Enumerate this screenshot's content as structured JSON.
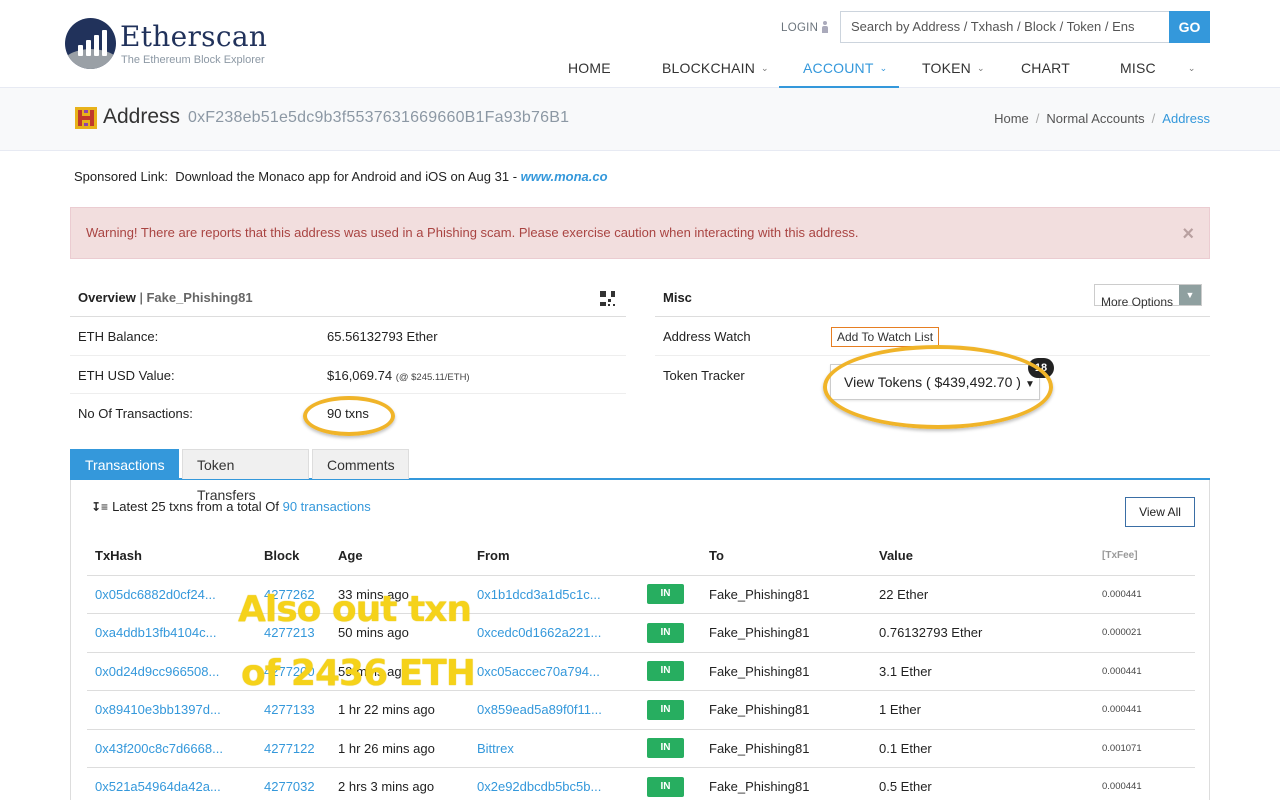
{
  "header": {
    "logo_name": "Etherscan",
    "logo_tagline": "The Ethereum Block Explorer",
    "login_label": "LOGIN",
    "search_placeholder": "Search by Address / Txhash / Block / Token / Ens",
    "go_label": "GO",
    "nav": [
      {
        "label": "HOME",
        "dropdown": false
      },
      {
        "label": "BLOCKCHAIN",
        "dropdown": true
      },
      {
        "label": "ACCOUNT",
        "dropdown": true,
        "active": true
      },
      {
        "label": "TOKEN",
        "dropdown": true
      },
      {
        "label": "CHART",
        "dropdown": false
      },
      {
        "label": "MISC",
        "dropdown": true
      }
    ]
  },
  "title": {
    "label": "Address",
    "hash": "0xF238eb51e5dc9b3f5537631669660B1Fa93b76B1",
    "breadcrumb": [
      "Home",
      "Normal Accounts",
      "Address"
    ]
  },
  "sponsored": {
    "prefix": "Sponsored Link:",
    "text": "Download the Monaco app for Android and iOS on Aug 31 -",
    "link": "www.mona.co"
  },
  "warning": {
    "text": "Warning! There are reports that this address was used in a Phishing scam. Please exercise caution when interacting with this address.",
    "close": "×"
  },
  "overview": {
    "title": "Overview",
    "name_tag": "Fake_Phishing81",
    "rows": [
      {
        "key": "ETH Balance:",
        "value": "65.56132793 Ether",
        "note": ""
      },
      {
        "key": "ETH USD Value:",
        "value": "$16,069.74",
        "note": "(@ $245.11/ETH)"
      },
      {
        "key": "No Of Transactions:",
        "value": "90 txns",
        "note": ""
      }
    ]
  },
  "misc": {
    "title": "Misc",
    "more_options": "More Options",
    "address_watch_label": "Address Watch",
    "watch_button": "Add To Watch List",
    "token_tracker_label": "Token Tracker",
    "tokens_button": "View Tokens ( $439,492.70 )",
    "tokens_badge": "18"
  },
  "tabs": [
    "Transactions",
    "Token Transfers",
    "Comments"
  ],
  "transactions": {
    "summary_prefix": "Latest 25 txns from a total Of",
    "summary_link": "90 transactions",
    "view_all": "View All",
    "columns": [
      "TxHash",
      "Block",
      "Age",
      "From",
      "",
      "To",
      "Value",
      "[TxFee]"
    ],
    "rows": [
      {
        "hash": "0x05dc6882d0cf24...",
        "block": "4277262",
        "age": "33 mins ago",
        "from": "0x1b1dcd3a1d5c1c...",
        "dir": "IN",
        "to": "Fake_Phishing81",
        "value": "22 Ether",
        "fee": "0.000441"
      },
      {
        "hash": "0xa4ddb13fb4104c...",
        "block": "4277213",
        "age": "50 mins ago",
        "from": "0xcedc0d1662a221...",
        "dir": "IN",
        "to": "Fake_Phishing81",
        "value": "0.76132793 Ether",
        "fee": "0.000021"
      },
      {
        "hash": "0x0d24d9cc966508...",
        "block": "4277200",
        "age": "59 mins ago",
        "from": "0xc05accec70a794...",
        "dir": "IN",
        "to": "Fake_Phishing81",
        "value": "3.1 Ether",
        "fee": "0.000441"
      },
      {
        "hash": "0x89410e3bb1397d...",
        "block": "4277133",
        "age": "1 hr 22 mins ago",
        "from": "0x859ead5a89f0f11...",
        "dir": "IN",
        "to": "Fake_Phishing81",
        "value": "1 Ether",
        "fee": "0.000441"
      },
      {
        "hash": "0x43f200c8c7d6668...",
        "block": "4277122",
        "age": "1 hr 26 mins ago",
        "from": "Bittrex",
        "dir": "IN",
        "to": "Fake_Phishing81",
        "value": "0.1 Ether",
        "fee": "0.001071"
      },
      {
        "hash": "0x521a54964da42a...",
        "block": "4277032",
        "age": "2 hrs 3 mins ago",
        "from": "0x2e92dbcdb5bc5b...",
        "dir": "IN",
        "to": "Fake_Phishing81",
        "value": "0.5 Ether",
        "fee": "0.000441"
      }
    ]
  },
  "annotation": {
    "line1": "Also out txn",
    "line2": "of 2436 ETH",
    "color": "#f0b429"
  }
}
